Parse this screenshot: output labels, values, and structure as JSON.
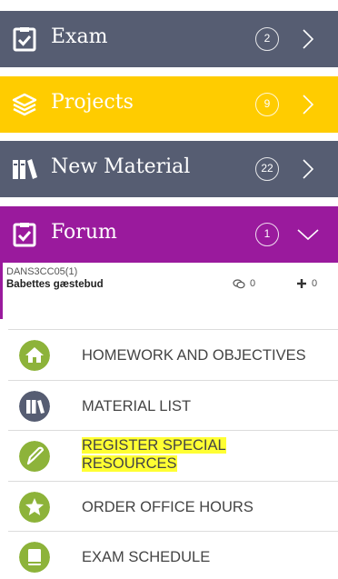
{
  "sections": {
    "exam": {
      "title": "Exam",
      "count": "2",
      "color": "#565d72"
    },
    "projects": {
      "title": "Projects",
      "count": "9",
      "color": "#ffcc00"
    },
    "new_material": {
      "title": "New Material",
      "count": "22",
      "color": "#565d72"
    },
    "forum": {
      "title": "Forum",
      "count": "1",
      "color": "#9a1a9d",
      "expanded": true
    }
  },
  "forum_entry": {
    "code": "DANS3CC05(1)",
    "name": "Babettes gæstebud",
    "comments": "0",
    "additions": "0"
  },
  "menu": {
    "homework": "HOMEWORK AND OBJECTIVES",
    "material_list": "MATERIAL LIST",
    "register_line1": "REGISTER SPECIAL",
    "register_line2": "RESOURCES",
    "office_hours": "ORDER OFFICE HOURS",
    "exam_schedule": "EXAM SCHEDULE"
  },
  "colors": {
    "icon_green": "#8db33a",
    "icon_navy": "#565d72",
    "highlight": "#ffff33"
  }
}
